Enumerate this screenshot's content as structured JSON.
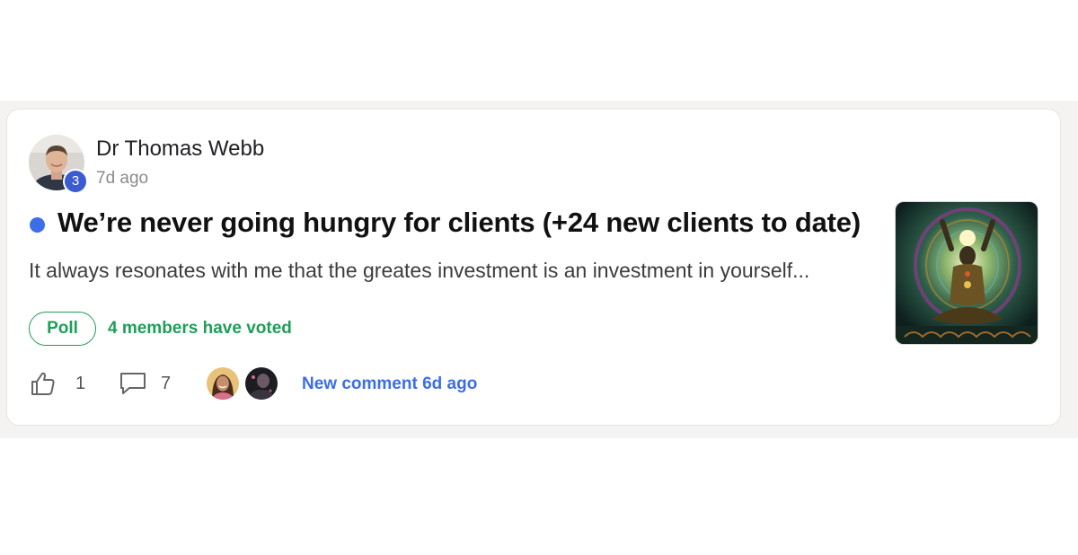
{
  "post": {
    "author": {
      "name": "Dr Thomas Webb",
      "level": "3",
      "time": "7d ago"
    },
    "title": "We’re never going hungry for clients (+24 new clients to date)",
    "excerpt": "It always resonates with me that the greates investment is an investment in yourself...",
    "poll": {
      "label": "Poll",
      "votes_text": "4 members have voted"
    },
    "likes": "1",
    "comments": "7",
    "new_comment_text": "New comment 6d ago"
  },
  "icons": {
    "like": "thumbs-up-icon",
    "comment": "comment-bubble-icon"
  },
  "colors": {
    "accent_blue": "#3b6ee8",
    "poll_green": "#1e9e57",
    "level_badge": "#3b5bd1"
  }
}
